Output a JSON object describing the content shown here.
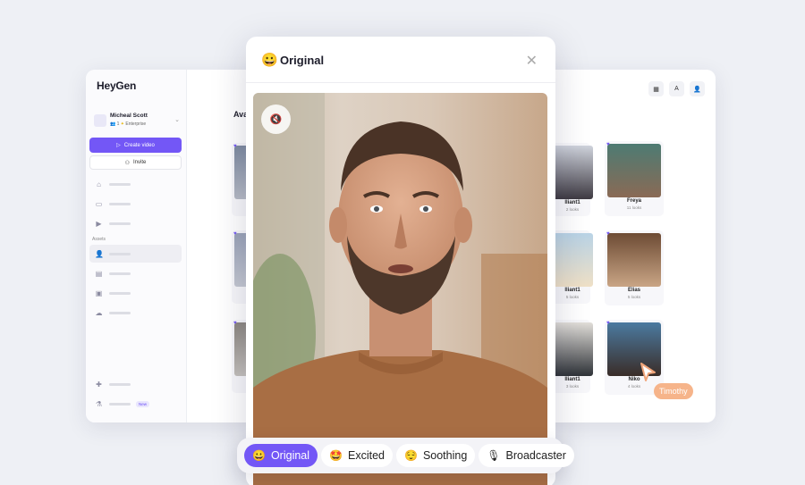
{
  "app": {
    "logo": "HeyGen",
    "user": {
      "name": "Micheal Scott",
      "seats": "1",
      "plan": "Enterprise"
    },
    "create_label": "Create video",
    "invite_label": "Invite",
    "assets_label": "Assets",
    "new_badge": "New",
    "section_title": "Ava",
    "avatars": [
      {
        "name": "lliant1",
        "looks": "2 looks"
      },
      {
        "name": "Freya",
        "looks": "11 looks"
      },
      {
        "name": "lliant1",
        "looks": "5 looks"
      },
      {
        "name": "Elias",
        "looks": "5 looks"
      },
      {
        "name": "lliant1",
        "looks": "3 looks"
      },
      {
        "name": "Niko",
        "looks": "4 looks"
      }
    ],
    "cursor_label": "Timothy"
  },
  "modal": {
    "emoji": "😀",
    "title": "Original",
    "close": "✕",
    "mute_icon": "🔇"
  },
  "moods": [
    {
      "icon": "😀",
      "label": "Original",
      "active": true
    },
    {
      "icon": "🤩",
      "label": "Excited",
      "active": false
    },
    {
      "icon": "😌",
      "label": "Soothing",
      "active": false
    },
    {
      "icon": "🎙",
      "label": "Broadcaster",
      "active": false
    }
  ]
}
